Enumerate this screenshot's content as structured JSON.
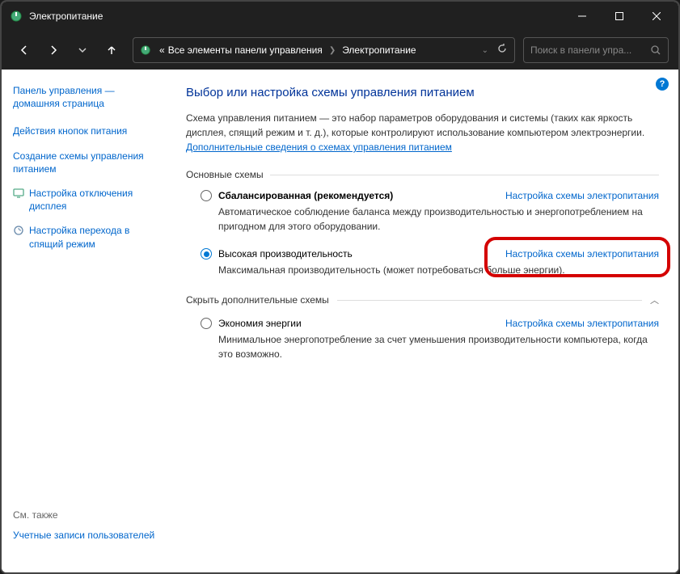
{
  "titlebar": {
    "title": "Электропитание"
  },
  "breadcrumb": {
    "prefix": "«",
    "item1": "Все элементы панели управления",
    "item2": "Электропитание"
  },
  "search": {
    "placeholder": "Поиск в панели упра..."
  },
  "sidebar": {
    "home": "Панель управления — домашняя страница",
    "links": {
      "l1": "Действия кнопок питания",
      "l2": "Создание схемы управления питанием",
      "l3": "Настройка отключения дисплея",
      "l4": "Настройка перехода в спящий режим"
    },
    "also_label": "См. также",
    "also_link": "Учетные записи пользователей"
  },
  "main": {
    "heading": "Выбор или настройка схемы управления питанием",
    "desc": "Схема управления питанием — это набор параметров оборудования и системы (таких как яркость дисплея, спящий режим и т. д.), которые контролируют использование компьютером электроэнергии. ",
    "desc_link": "Дополнительные сведения о схемах управления питанием",
    "section1": "Основные схемы",
    "plan1": {
      "name": "Сбалансированная (рекомендуется)",
      "link": "Настройка схемы электропитания",
      "desc": "Автоматическое соблюдение баланса между производительностью и энергопотреблением на пригодном для этого оборудовании."
    },
    "plan2": {
      "name": "Высокая производительность",
      "link": "Настройка схемы электропитания",
      "desc": "Максимальная производительность (может потребоваться больше энергии)."
    },
    "collapse": "Скрыть дополнительные схемы",
    "plan3": {
      "name": "Экономия энергии",
      "link": "Настройка схемы электропитания",
      "desc": "Минимальное энергопотребление за счет уменьшения производительности компьютера, когда это возможно."
    }
  }
}
